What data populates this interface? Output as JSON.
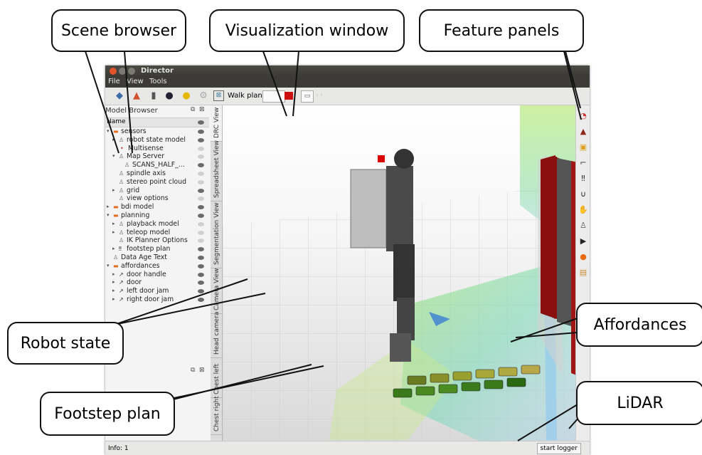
{
  "callouts": {
    "scene_browser": "Scene browser",
    "visualization_window": "Visualization window",
    "feature_panels": "Feature panels",
    "robot_state": "Robot state",
    "affordances": "Affordances",
    "footstep_plan": "Footstep plan",
    "lidar": "LiDAR"
  },
  "window": {
    "title": "Director",
    "menu": [
      "File",
      "View",
      "Tools"
    ],
    "toolbar": {
      "walk_plan_label": "Walk plan:"
    }
  },
  "model_browser": {
    "title": "Model Browser",
    "column_header": "Name",
    "items": [
      {
        "label": "sensors"
      },
      {
        "label": "robot state model"
      },
      {
        "label": "Multisense"
      },
      {
        "label": "Map Server"
      },
      {
        "label": "SCANS_HALF_..."
      },
      {
        "label": "spindle axis"
      },
      {
        "label": "stereo point cloud"
      },
      {
        "label": "grid"
      },
      {
        "label": "view options"
      },
      {
        "label": "bdi model"
      },
      {
        "label": "planning"
      },
      {
        "label": "playback model"
      },
      {
        "label": "teleop model"
      },
      {
        "label": "IK Planner Options"
      },
      {
        "label": "footstep plan"
      },
      {
        "label": "Data Age Text"
      },
      {
        "label": "affordances"
      },
      {
        "label": "door handle"
      },
      {
        "label": "door"
      },
      {
        "label": "left door jam"
      },
      {
        "label": "right door jam"
      }
    ]
  },
  "view_tabs": [
    "DRC View",
    "Spreadsheet View",
    "Segmentation View",
    "Camera View",
    "Head camera",
    "Chest left",
    "Chest right"
  ],
  "feature_panel_icons": [
    "gauge-icon",
    "mortarboard-icon",
    "map-icon",
    "robot-arm-icon",
    "footsteps-icon",
    "gripper-icon",
    "hand-icon",
    "teleop-icon",
    "camera-icon",
    "warning-icon",
    "notes-icon"
  ],
  "status": {
    "info": "Info: 1",
    "logger_button": "start logger"
  }
}
